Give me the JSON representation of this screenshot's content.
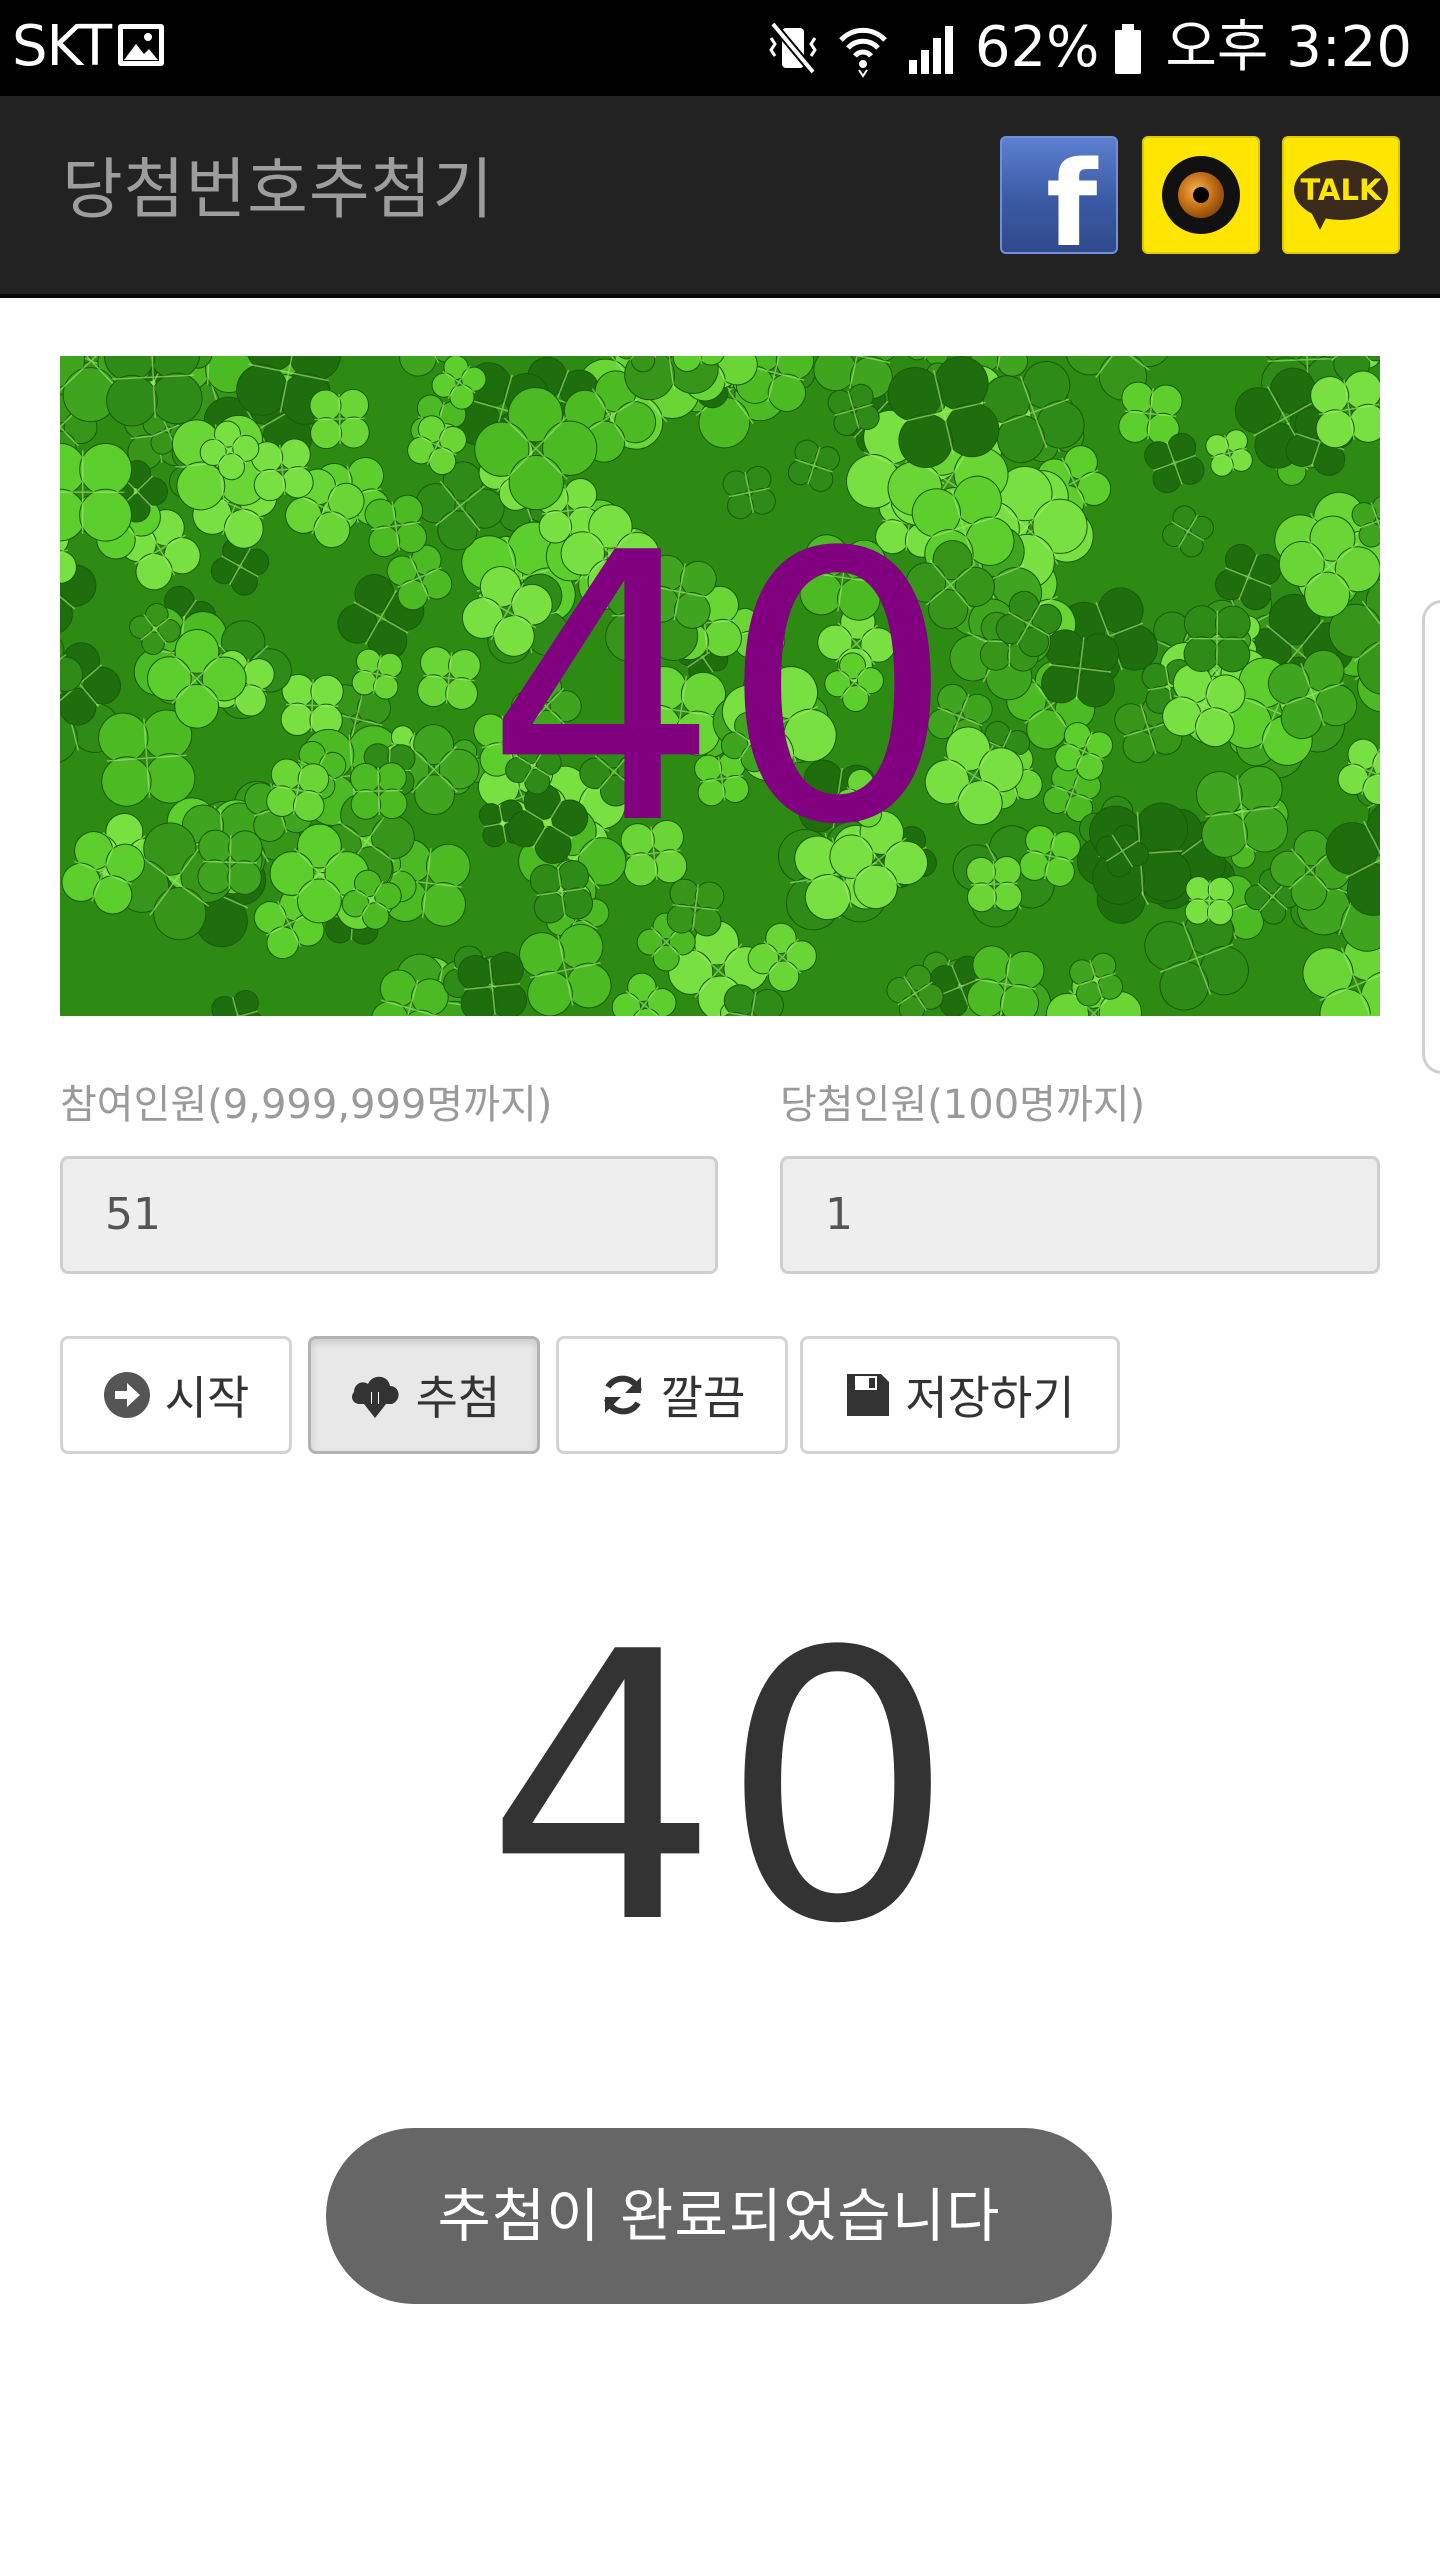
{
  "status_bar": {
    "carrier": "SKT",
    "battery": "62%",
    "time": "오후 3:20",
    "icons": [
      "gallery-icon",
      "vibrate-icon",
      "wifi-icon",
      "signal-icon",
      "battery-icon"
    ]
  },
  "app": {
    "title": "당첨번호추첨기",
    "share_buttons": [
      {
        "name": "facebook",
        "icon": "facebook-icon",
        "color": "#3b5aa4"
      },
      {
        "name": "kakaostory",
        "icon": "kakaostory-icon",
        "color": "#ffe600"
      },
      {
        "name": "kakaotalk",
        "icon": "kakaotalk-icon",
        "label": "TALK",
        "color": "#ffe600"
      }
    ]
  },
  "draw_display": {
    "number": "40",
    "number_color": "#800080"
  },
  "form": {
    "participants": {
      "label": "참여인원(9,999,999명까지)",
      "value": "51"
    },
    "winners": {
      "label": "당첨인원(100명까지)",
      "value": "1"
    }
  },
  "buttons": {
    "start": {
      "label": "시작",
      "icon": "arrow-circle-right-icon"
    },
    "draw": {
      "label": "추첨",
      "icon": "cloud-download-icon",
      "active": true
    },
    "clear": {
      "label": "깔끔",
      "icon": "refresh-icon"
    },
    "save": {
      "label": "저장하기",
      "icon": "floppy-disk-icon"
    }
  },
  "result": {
    "number": "40"
  },
  "toast": {
    "message": "추첨이 완료되었습니다"
  }
}
